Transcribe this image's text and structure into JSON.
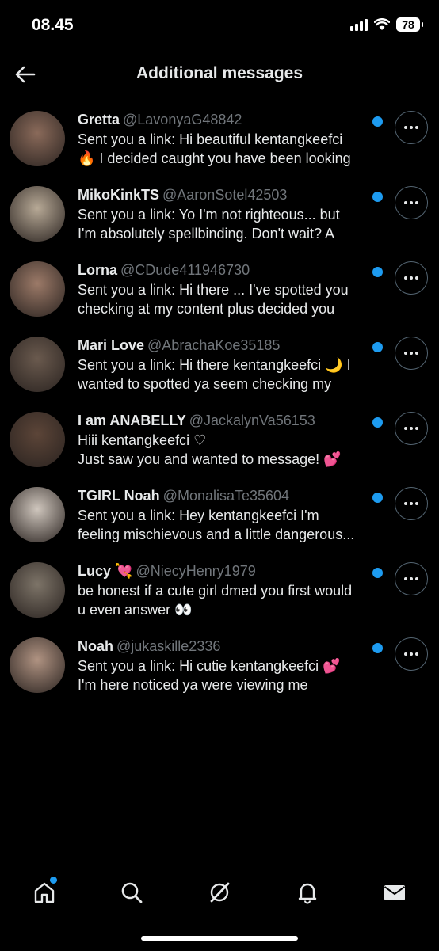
{
  "status": {
    "time": "08.45",
    "battery": "78"
  },
  "header": {
    "title": "Additional messages"
  },
  "messages": [
    {
      "name": "Gretta",
      "handle": "@LavonyaG48842",
      "line1": "Sent you a link: Hi beautiful kentangkeefci",
      "line2": "🔥 I decided caught you have been looking",
      "avatar_color": "#8a6a5a"
    },
    {
      "name": "MikoKinkTS",
      "handle": "@AaronSotel42503",
      "line1": "Sent you a link: Yo I'm not righteous... but",
      "line2": "I'm absolutely spellbinding. Don't wait? A",
      "avatar_color": "#b7a996"
    },
    {
      "name": "Lorna",
      "handle": "@CDude411946730",
      "line1": "Sent you a link: Hi there ... I've spotted you",
      "line2": "checking at my content plus decided you",
      "avatar_color": "#9c7a68"
    },
    {
      "name": "Mari Love",
      "handle": "@AbrachaKoe35185",
      "line1": "Sent you a link: Hi there kentangkeefci 🌙 I",
      "line2": "wanted to spotted ya seem checking my",
      "avatar_color": "#6a5a4e"
    },
    {
      "name": "I am ANABELLY",
      "handle": "@JackalynVa56153",
      "line1": "Hiii kentangkeefci ♡",
      "line2": "Just saw you and wanted to message! 💕",
      "avatar_color": "#5c4538"
    },
    {
      "name": "TGIRL Noah",
      "handle": "@MonalisaTe35604",
      "line1": "Sent you a link: Hey kentangkeefci I'm",
      "line2": "feeling mischievous and a little dangerous...",
      "avatar_color": "#cfc6bd"
    },
    {
      "name": "Lucy 💘",
      "handle": "@NiecyHenry1979",
      "line1": "be honest if a cute girl dmed you first would",
      "line2": "u even answer 👀",
      "avatar_color": "#7d7468"
    },
    {
      "name": "Noah",
      "handle": "@jukaskille2336",
      "line1": "Sent you a link: Hi cutie kentangkeefci 💕",
      "line2": "I'm here noticed ya were viewing me",
      "avatar_color": "#b09382"
    }
  ],
  "tabbar": {
    "items": [
      "home-icon",
      "search-icon",
      "grok-icon",
      "bell-icon",
      "mail-icon"
    ],
    "accent": "#1d9bf0"
  }
}
